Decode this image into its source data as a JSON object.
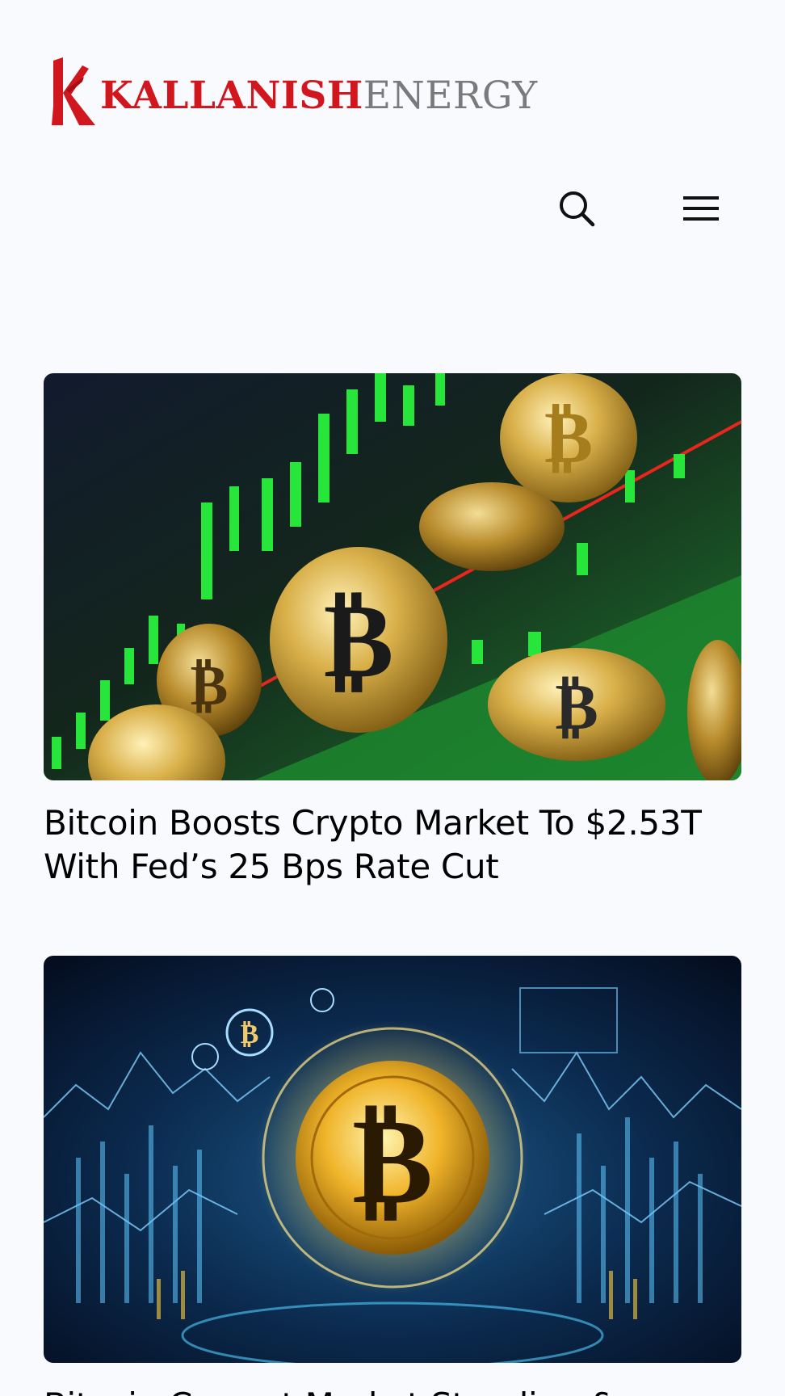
{
  "header": {
    "logo": {
      "brand_primary": "KALLANISH",
      "brand_secondary": "ENERGY",
      "primary_color": "#d2161e",
      "secondary_color": "#7a7a7a"
    },
    "search_icon": "search-icon",
    "menu_icon": "hamburger-menu-icon"
  },
  "articles": [
    {
      "title": "Bitcoin Boosts Crypto Market To $2.53T With Fed’s 25 Bps Rate Cut",
      "image_subject": "gold bitcoins over green candlestick chart"
    },
    {
      "title": "Bitcoin Current Market Standing &",
      "image_subject": "glowing bitcoin over blue financial charts"
    }
  ],
  "colors": {
    "background": "#f9fafe",
    "text": "#000000"
  }
}
